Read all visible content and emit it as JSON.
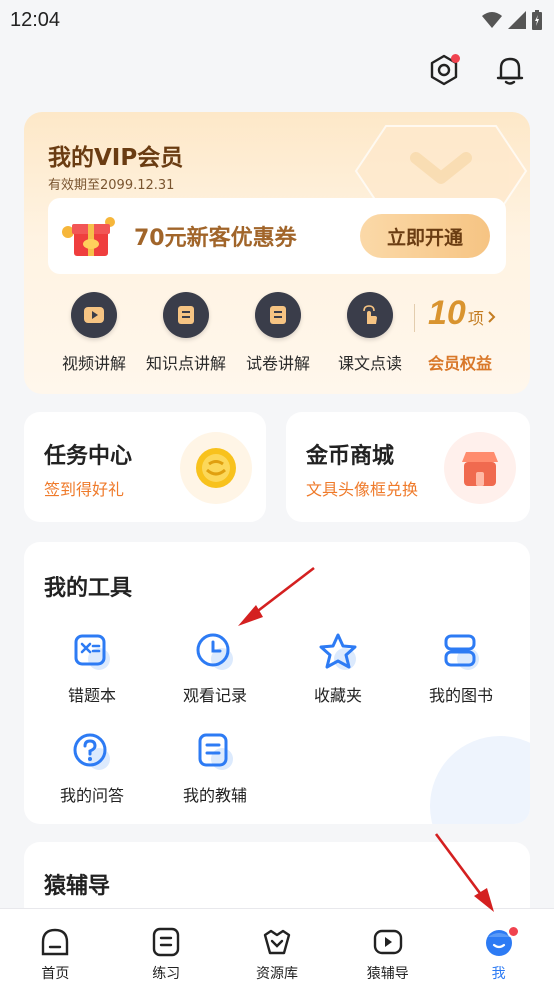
{
  "status_bar": {
    "time": "12:04"
  },
  "top_actions": {
    "settings_icon": "settings-hex-icon",
    "bell_icon": "bell-icon"
  },
  "vip": {
    "title": "我的VIP会员",
    "expiry": "有效期至2099.12.31",
    "coupon_text": "70元新客优惠券",
    "coupon_button": "立即开通",
    "benefits": [
      {
        "label": "视频讲解",
        "icon": "play-icon"
      },
      {
        "label": "知识点讲解",
        "icon": "book-icon"
      },
      {
        "label": "试卷讲解",
        "icon": "paper-icon"
      },
      {
        "label": "课文点读",
        "icon": "tap-icon"
      }
    ],
    "benefit_count": "10",
    "benefit_unit": "项",
    "benefit_more_label": "会员权益"
  },
  "task_center": {
    "title": "任务中心",
    "subtitle": "签到得好礼"
  },
  "coin_mall": {
    "title": "金币商城",
    "subtitle": "文具头像框兑换"
  },
  "tools": {
    "title": "我的工具",
    "items": [
      {
        "label": "错题本",
        "icon": "wrong-questions-icon"
      },
      {
        "label": "观看记录",
        "icon": "clock-icon"
      },
      {
        "label": "收藏夹",
        "icon": "star-icon"
      },
      {
        "label": "我的图书",
        "icon": "books-icon"
      },
      {
        "label": "我的问答",
        "icon": "question-icon"
      },
      {
        "label": "我的教辅",
        "icon": "tutor-book-icon"
      }
    ]
  },
  "yuan_fudao": {
    "title": "猿辅导"
  },
  "bottom_nav": {
    "items": [
      {
        "label": "首页",
        "icon": "home-icon"
      },
      {
        "label": "练习",
        "icon": "practice-icon"
      },
      {
        "label": "资源库",
        "icon": "resources-icon"
      },
      {
        "label": "猿辅导",
        "icon": "video-icon"
      },
      {
        "label": "我",
        "icon": "profile-icon"
      }
    ],
    "active": "我"
  },
  "colors": {
    "accent_blue": "#2d7bf4",
    "vip_brown": "#6a3c12",
    "orange": "#ef7a2a",
    "badge_red": "#f0434f",
    "annotation_red": "#d42020"
  }
}
